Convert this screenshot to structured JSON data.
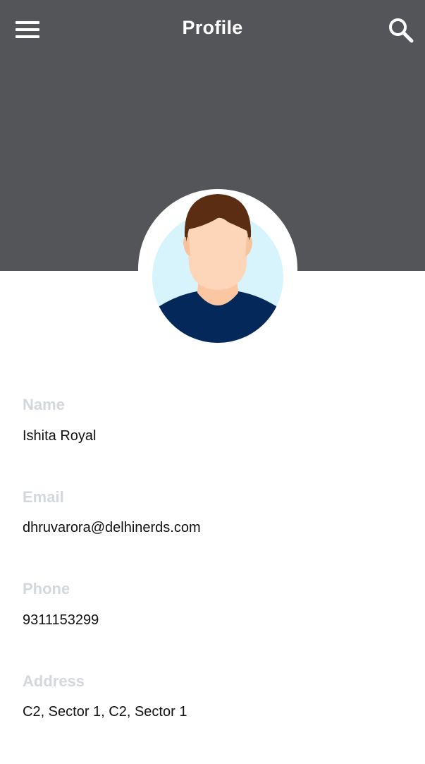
{
  "header": {
    "title": "Profile",
    "menu_icon": "hamburger-menu-icon",
    "search_icon": "search-icon",
    "background_color": "#545559"
  },
  "avatar": {
    "icon": "user-avatar-icon"
  },
  "profile": {
    "fields": [
      {
        "label": "Name",
        "value": "Ishita Royal"
      },
      {
        "label": "Email",
        "value": "dhruvarora@delhinerds.com"
      },
      {
        "label": "Phone",
        "value": "9311153299"
      },
      {
        "label": "Address",
        "value": "C2, Sector 1, C2, Sector 1"
      }
    ]
  }
}
